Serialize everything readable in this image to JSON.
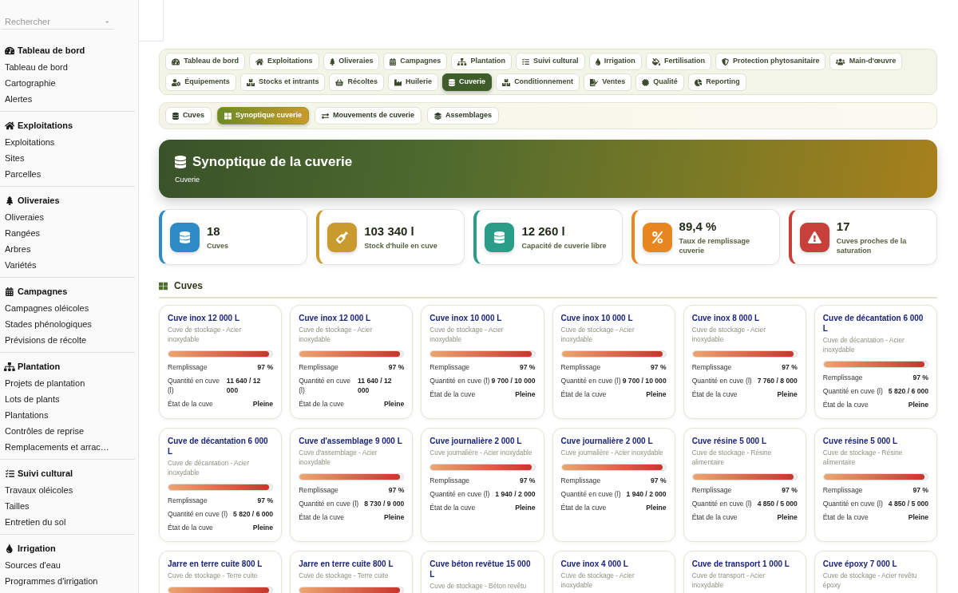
{
  "sidebar": {
    "search": {
      "placeholder": "Rechercher"
    },
    "sections": [
      {
        "title": "Tableau de bord",
        "items": [
          "Tableau de bord",
          "Cartographie",
          "Alertes"
        ]
      },
      {
        "title": "Exploitations",
        "items": [
          "Exploitations",
          "Sites",
          "Parcelles"
        ]
      },
      {
        "title": "Oliveraies",
        "items": [
          "Oliveraies",
          "Rangées",
          "Arbres",
          "Variétés"
        ]
      },
      {
        "title": "Campagnes",
        "items": [
          "Campagnes oléicoles",
          "Stades phénologiques",
          "Prévisions de récolte"
        ]
      },
      {
        "title": "Plantation",
        "items": [
          "Projets de plantation",
          "Lots de plants",
          "Plantations",
          "Contrôles de reprise",
          "Remplacements et arrac…"
        ]
      },
      {
        "title": "Suivi cultural",
        "items": [
          "Travaux oléicoles",
          "Tailles",
          "Entretien du sol"
        ]
      },
      {
        "title": "Irrigation",
        "items": [
          "Sources d'eau",
          "Programmes d'irrigation"
        ]
      }
    ]
  },
  "nav": {
    "tabs": [
      {
        "label": "Tableau de bord",
        "selected": false
      },
      {
        "label": "Exploitations",
        "selected": false
      },
      {
        "label": "Oliveraies",
        "selected": false
      },
      {
        "label": "Campagnes",
        "selected": false
      },
      {
        "label": "Plantation",
        "selected": false
      },
      {
        "label": "Suivi cultural",
        "selected": false
      },
      {
        "label": "Irrigation",
        "selected": false
      },
      {
        "label": "Fertilisation",
        "selected": false
      },
      {
        "label": "Protection phytosanitaire",
        "selected": false
      },
      {
        "label": "Main-d'œuvre",
        "selected": false
      },
      {
        "label": "Équipements",
        "selected": false
      },
      {
        "label": "Stocks et intrants",
        "selected": false
      },
      {
        "label": "Récoltes",
        "selected": false
      },
      {
        "label": "Huilerie",
        "selected": false
      },
      {
        "label": "Cuverie",
        "selected": true
      },
      {
        "label": "Conditionnement",
        "selected": false
      },
      {
        "label": "Ventes",
        "selected": false
      },
      {
        "label": "Qualité",
        "selected": false
      },
      {
        "label": "Reporting",
        "selected": false
      }
    ]
  },
  "subnav": {
    "tabs": [
      {
        "label": "Cuves",
        "selected": false
      },
      {
        "label": "Synoptique cuverie",
        "selected": true
      },
      {
        "label": "Mouvements de cuverie",
        "selected": false
      },
      {
        "label": "Assemblages",
        "selected": false
      }
    ]
  },
  "banner": {
    "title": "Synoptique de la cuverie",
    "subtitle": "Cuverie"
  },
  "stats": [
    {
      "value": "18",
      "label": "Cuves",
      "color": "#2f8bc6"
    },
    {
      "value": "103 340 l",
      "label": "Stock d'huile en cuve",
      "color": "#c99a2e"
    },
    {
      "value": "12 260 l",
      "label": "Capacité de cuverie libre",
      "color": "#2a9d88"
    },
    {
      "value": "89,4 %",
      "label": "Taux de remplissage cuverie",
      "color": "#e8871f"
    },
    {
      "value": "17",
      "label": "Cuves proches de la saturation",
      "color": "#c8403a"
    }
  ],
  "section": {
    "title": "Cuves"
  },
  "tanks": [
    {
      "name": "Cuve inox 12 000 L",
      "type": "Cuve de stockage - Acier inoxydable",
      "level": 0.97,
      "fields": [
        {
          "label": "Remplissage",
          "value": "97 %"
        },
        {
          "label": "Quantité en cuve (l)",
          "value": "11 640 / 12 000"
        },
        {
          "label": "État de la cuve",
          "value": "Pleine"
        }
      ]
    },
    {
      "name": "Cuve inox 12 000 L",
      "type": "Cuve de stockage - Acier inoxydable",
      "level": 0.97,
      "fields": [
        {
          "label": "Remplissage",
          "value": "97 %"
        },
        {
          "label": "Quantité en cuve (l)",
          "value": "11 640 / 12 000"
        },
        {
          "label": "État de la cuve",
          "value": "Pleine"
        }
      ]
    },
    {
      "name": "Cuve inox 10 000 L",
      "type": "Cuve de stockage - Acier inoxydable",
      "level": 0.97,
      "fields": [
        {
          "label": "Remplissage",
          "value": "97 %"
        },
        {
          "label": "Quantité en cuve (l)",
          "value": "9 700 / 10 000"
        },
        {
          "label": "État de la cuve",
          "value": "Pleine"
        }
      ]
    },
    {
      "name": "Cuve inox 10 000 L",
      "type": "Cuve de stockage - Acier inoxydable",
      "level": 0.97,
      "fields": [
        {
          "label": "Remplissage",
          "value": "97 %"
        },
        {
          "label": "Quantité en cuve (l)",
          "value": "9 700 / 10 000"
        },
        {
          "label": "État de la cuve",
          "value": "Pleine"
        }
      ]
    },
    {
      "name": "Cuve inox 8 000 L",
      "type": "Cuve de stockage - Acier inoxydable",
      "level": 0.97,
      "fields": [
        {
          "label": "Remplissage",
          "value": "97 %"
        },
        {
          "label": "Quantité en cuve (l)",
          "value": "7 760 / 8 000"
        },
        {
          "label": "État de la cuve",
          "value": "Pleine"
        }
      ]
    },
    {
      "name": "Cuve de décantation 6 000 L",
      "type": "Cuve de décantation - Acier inoxydable",
      "level": 0.97,
      "fields": [
        {
          "label": "Remplissage",
          "value": "97 %"
        },
        {
          "label": "Quantité en cuve (l)",
          "value": "5 820 / 6 000"
        },
        {
          "label": "État de la cuve",
          "value": "Pleine"
        }
      ]
    },
    {
      "name": "Cuve de décantation 6 000 L",
      "type": "Cuve de décantation - Acier inoxydable",
      "level": 0.97,
      "fields": [
        {
          "label": "Remplissage",
          "value": "97 %"
        },
        {
          "label": "Quantité en cuve (l)",
          "value": "5 820 / 6 000"
        },
        {
          "label": "État de la cuve",
          "value": "Pleine"
        }
      ]
    },
    {
      "name": "Cuve d'assemblage 9 000 L",
      "type": "Cuve d'assemblage - Acier inoxydable",
      "level": 0.97,
      "fields": [
        {
          "label": "Remplissage",
          "value": "97 %"
        },
        {
          "label": "Quantité en cuve (l)",
          "value": "8 730 / 9 000"
        },
        {
          "label": "État de la cuve",
          "value": "Pleine"
        }
      ]
    },
    {
      "name": "Cuve journalière 2 000 L",
      "type": "Cuve journalière - Acier inoxydable",
      "level": 0.97,
      "fields": [
        {
          "label": "Remplissage",
          "value": "97 %"
        },
        {
          "label": "Quantité en cuve (l)",
          "value": "1 940 / 2 000"
        },
        {
          "label": "État de la cuve",
          "value": "Pleine"
        }
      ]
    },
    {
      "name": "Cuve journalière 2 000 L",
      "type": "Cuve journalière - Acier inoxydable",
      "level": 0.97,
      "fields": [
        {
          "label": "Remplissage",
          "value": "97 %"
        },
        {
          "label": "Quantité en cuve (l)",
          "value": "1 940 / 2 000"
        },
        {
          "label": "État de la cuve",
          "value": "Pleine"
        }
      ]
    },
    {
      "name": "Cuve résine 5 000 L",
      "type": "Cuve de stockage - Résine alimentaire",
      "level": 0.97,
      "fields": [
        {
          "label": "Remplissage",
          "value": "97 %"
        },
        {
          "label": "Quantité en cuve (l)",
          "value": "4 850 / 5 000"
        },
        {
          "label": "État de la cuve",
          "value": "Pleine"
        }
      ]
    },
    {
      "name": "Cuve résine 5 000 L",
      "type": "Cuve de stockage - Résine alimentaire",
      "level": 0.97,
      "fields": [
        {
          "label": "Remplissage",
          "value": "97 %"
        },
        {
          "label": "Quantité en cuve (l)",
          "value": "4 850 / 5 000"
        },
        {
          "label": "État de la cuve",
          "value": "Pleine"
        }
      ]
    },
    {
      "name": "Jarre en terre cuite 800 L",
      "type": "Cuve de stockage - Terre cuite",
      "level": 0.97
    },
    {
      "name": "Jarre en terre cuite 800 L",
      "type": "Cuve de stockage - Terre cuite",
      "level": 0.97
    },
    {
      "name": "Cuve béton revêtue 15 000 L",
      "type": "Cuve de stockage - Béton revêtu"
    },
    {
      "name": "Cuve inox 4 000 L",
      "type": "Cuve de stockage - Acier inoxydable"
    },
    {
      "name": "Cuve de transport 1 000 L",
      "type": "Cuve de transport - Acier inoxydable"
    },
    {
      "name": "Cuve époxy 7 000 L",
      "type": "Cuve de stockage - Acier revêtu époxy"
    }
  ]
}
